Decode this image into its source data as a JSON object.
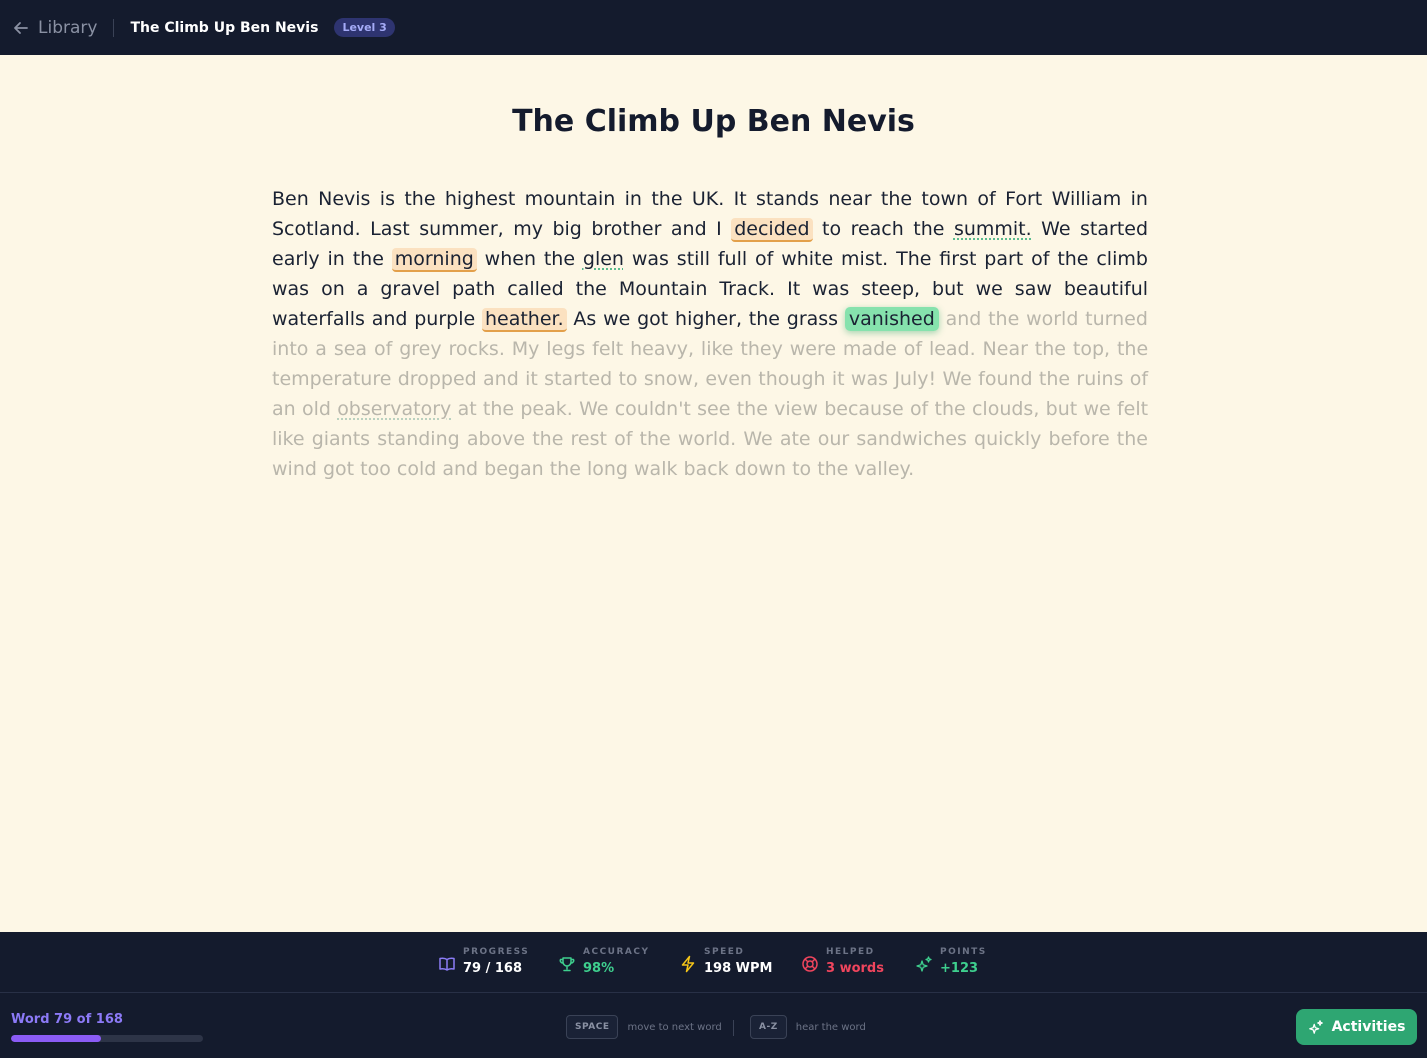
{
  "header": {
    "back_label": "Library",
    "book_title": "The Climb Up Ben Nevis",
    "level_badge": "Level 3"
  },
  "story": {
    "title": "The Climb Up Ben Nevis",
    "current_word_index": 78,
    "words": [
      {
        "t": "Ben",
        "s": "read"
      },
      {
        "t": "Nevis",
        "s": "read"
      },
      {
        "t": "is",
        "s": "read"
      },
      {
        "t": "the",
        "s": "read"
      },
      {
        "t": "highest",
        "s": "read"
      },
      {
        "t": "mountain",
        "s": "read"
      },
      {
        "t": "in",
        "s": "read"
      },
      {
        "t": "the",
        "s": "read"
      },
      {
        "t": "UK.",
        "s": "read"
      },
      {
        "t": "It",
        "s": "read"
      },
      {
        "t": "stands",
        "s": "read"
      },
      {
        "t": "near",
        "s": "read"
      },
      {
        "t": "the",
        "s": "read"
      },
      {
        "t": "town",
        "s": "read"
      },
      {
        "t": "of",
        "s": "read"
      },
      {
        "t": "Fort",
        "s": "read"
      },
      {
        "t": "William",
        "s": "read"
      },
      {
        "t": "in",
        "s": "read"
      },
      {
        "t": "Scotland.",
        "s": "read"
      },
      {
        "t": "Last",
        "s": "read"
      },
      {
        "t": "summer,",
        "s": "read"
      },
      {
        "t": "my",
        "s": "read"
      },
      {
        "t": "big",
        "s": "read"
      },
      {
        "t": "brother",
        "s": "read"
      },
      {
        "t": "and",
        "s": "read"
      },
      {
        "t": "I",
        "s": "read"
      },
      {
        "t": "decided",
        "s": "helped"
      },
      {
        "t": "to",
        "s": "read"
      },
      {
        "t": "reach",
        "s": "read"
      },
      {
        "t": "the",
        "s": "read"
      },
      {
        "t": "summit.",
        "s": "read",
        "gloss": true
      },
      {
        "t": "We",
        "s": "read"
      },
      {
        "t": "started",
        "s": "read"
      },
      {
        "t": "early",
        "s": "read"
      },
      {
        "t": "in",
        "s": "read"
      },
      {
        "t": "the",
        "s": "read"
      },
      {
        "t": "morning",
        "s": "helped"
      },
      {
        "t": "when",
        "s": "read"
      },
      {
        "t": "the",
        "s": "read"
      },
      {
        "t": "glen",
        "s": "read",
        "gloss": true
      },
      {
        "t": "was",
        "s": "read"
      },
      {
        "t": "still",
        "s": "read"
      },
      {
        "t": "full",
        "s": "read"
      },
      {
        "t": "of",
        "s": "read"
      },
      {
        "t": "white",
        "s": "read"
      },
      {
        "t": "mist.",
        "s": "read"
      },
      {
        "t": "The",
        "s": "read"
      },
      {
        "t": "first",
        "s": "read"
      },
      {
        "t": "part",
        "s": "read"
      },
      {
        "t": "of",
        "s": "read"
      },
      {
        "t": "the",
        "s": "read"
      },
      {
        "t": "climb",
        "s": "read"
      },
      {
        "t": "was",
        "s": "read"
      },
      {
        "t": "on",
        "s": "read"
      },
      {
        "t": "a",
        "s": "read"
      },
      {
        "t": "gravel",
        "s": "read"
      },
      {
        "t": "path",
        "s": "read"
      },
      {
        "t": "called",
        "s": "read"
      },
      {
        "t": "the",
        "s": "read"
      },
      {
        "t": "Mountain",
        "s": "read"
      },
      {
        "t": "Track.",
        "s": "read"
      },
      {
        "t": "It",
        "s": "read"
      },
      {
        "t": "was",
        "s": "read"
      },
      {
        "t": "steep,",
        "s": "read"
      },
      {
        "t": "but",
        "s": "read"
      },
      {
        "t": "we",
        "s": "read"
      },
      {
        "t": "saw",
        "s": "read"
      },
      {
        "t": "beautiful",
        "s": "read"
      },
      {
        "t": "waterfalls",
        "s": "read"
      },
      {
        "t": "and",
        "s": "read"
      },
      {
        "t": "purple",
        "s": "read"
      },
      {
        "t": "heather.",
        "s": "helped"
      },
      {
        "t": "As",
        "s": "read"
      },
      {
        "t": "we",
        "s": "read"
      },
      {
        "t": "got",
        "s": "read"
      },
      {
        "t": "higher,",
        "s": "read"
      },
      {
        "t": "the",
        "s": "read"
      },
      {
        "t": "grass",
        "s": "read"
      },
      {
        "t": "vanished",
        "s": "current"
      },
      {
        "t": "and",
        "s": "future"
      },
      {
        "t": "the",
        "s": "future"
      },
      {
        "t": "world",
        "s": "future"
      },
      {
        "t": "turned",
        "s": "future"
      },
      {
        "t": "into",
        "s": "future"
      },
      {
        "t": "a",
        "s": "future"
      },
      {
        "t": "sea",
        "s": "future"
      },
      {
        "t": "of",
        "s": "future"
      },
      {
        "t": "grey",
        "s": "future"
      },
      {
        "t": "rocks.",
        "s": "future"
      },
      {
        "t": "My",
        "s": "future"
      },
      {
        "t": "legs",
        "s": "future"
      },
      {
        "t": "felt",
        "s": "future"
      },
      {
        "t": "heavy,",
        "s": "future"
      },
      {
        "t": "like",
        "s": "future"
      },
      {
        "t": "they",
        "s": "future"
      },
      {
        "t": "were",
        "s": "future"
      },
      {
        "t": "made",
        "s": "future"
      },
      {
        "t": "of",
        "s": "future"
      },
      {
        "t": "lead.",
        "s": "future"
      },
      {
        "t": "Near",
        "s": "future"
      },
      {
        "t": "the",
        "s": "future"
      },
      {
        "t": "top,",
        "s": "future"
      },
      {
        "t": "the",
        "s": "future"
      },
      {
        "t": "temperature",
        "s": "future"
      },
      {
        "t": "dropped",
        "s": "future"
      },
      {
        "t": "and",
        "s": "future"
      },
      {
        "t": "it",
        "s": "future"
      },
      {
        "t": "started",
        "s": "future"
      },
      {
        "t": "to",
        "s": "future"
      },
      {
        "t": "snow,",
        "s": "future"
      },
      {
        "t": "even",
        "s": "future"
      },
      {
        "t": "though",
        "s": "future"
      },
      {
        "t": "it",
        "s": "future"
      },
      {
        "t": "was",
        "s": "future"
      },
      {
        "t": "July!",
        "s": "future"
      },
      {
        "t": "We",
        "s": "future"
      },
      {
        "t": "found",
        "s": "future"
      },
      {
        "t": "the",
        "s": "future"
      },
      {
        "t": "ruins",
        "s": "future"
      },
      {
        "t": "of",
        "s": "future"
      },
      {
        "t": "an",
        "s": "future"
      },
      {
        "t": "old",
        "s": "future"
      },
      {
        "t": "observatory",
        "s": "future",
        "gloss": true
      },
      {
        "t": "at",
        "s": "future"
      },
      {
        "t": "the",
        "s": "future"
      },
      {
        "t": "peak.",
        "s": "future"
      },
      {
        "t": "We",
        "s": "future"
      },
      {
        "t": "couldn't",
        "s": "future"
      },
      {
        "t": "see",
        "s": "future"
      },
      {
        "t": "the",
        "s": "future"
      },
      {
        "t": "view",
        "s": "future"
      },
      {
        "t": "because",
        "s": "future"
      },
      {
        "t": "of",
        "s": "future"
      },
      {
        "t": "the",
        "s": "future"
      },
      {
        "t": "clouds,",
        "s": "future"
      },
      {
        "t": "but",
        "s": "future"
      },
      {
        "t": "we",
        "s": "future"
      },
      {
        "t": "felt",
        "s": "future"
      },
      {
        "t": "like",
        "s": "future"
      },
      {
        "t": "giants",
        "s": "future"
      },
      {
        "t": "standing",
        "s": "future"
      },
      {
        "t": "above",
        "s": "future"
      },
      {
        "t": "the",
        "s": "future"
      },
      {
        "t": "rest",
        "s": "future"
      },
      {
        "t": "of",
        "s": "future"
      },
      {
        "t": "the",
        "s": "future"
      },
      {
        "t": "world.",
        "s": "future"
      },
      {
        "t": "We",
        "s": "future"
      },
      {
        "t": "ate",
        "s": "future"
      },
      {
        "t": "our",
        "s": "future"
      },
      {
        "t": "sandwiches",
        "s": "future"
      },
      {
        "t": "quickly",
        "s": "future"
      },
      {
        "t": "before",
        "s": "future"
      },
      {
        "t": "the",
        "s": "future"
      },
      {
        "t": "wind",
        "s": "future"
      },
      {
        "t": "got",
        "s": "future"
      },
      {
        "t": "too",
        "s": "future"
      },
      {
        "t": "cold",
        "s": "future"
      },
      {
        "t": "and",
        "s": "future"
      },
      {
        "t": "began",
        "s": "future"
      },
      {
        "t": "the",
        "s": "future"
      },
      {
        "t": "long",
        "s": "future"
      },
      {
        "t": "walk",
        "s": "future"
      },
      {
        "t": "back",
        "s": "future"
      },
      {
        "t": "down",
        "s": "future"
      },
      {
        "t": "to",
        "s": "future"
      },
      {
        "t": "the",
        "s": "future"
      },
      {
        "t": "valley.",
        "s": "future"
      }
    ]
  },
  "stats": {
    "progress": {
      "label": "PROGRESS",
      "value": "79 / 168",
      "icon": "book-open-icon",
      "color": "#ffffff",
      "icon_color": "#8b7cf6"
    },
    "accuracy": {
      "label": "ACCURACY",
      "value": "98%",
      "icon": "trophy-icon",
      "color": "#3ecf8e",
      "icon_color": "#3ecf8e"
    },
    "speed": {
      "label": "SPEED",
      "value": "198 WPM",
      "icon": "lightning-icon",
      "color": "#ffffff",
      "icon_color": "#f5c518"
    },
    "helped": {
      "label": "HELPED",
      "value": "3 words",
      "icon": "lifebuoy-icon",
      "color": "#f0455d",
      "icon_color": "#f0455d"
    },
    "points": {
      "label": "POINTS",
      "value": "+123",
      "icon": "sparkles-icon",
      "color": "#3ecf8e",
      "icon_color": "#3ecf8e"
    }
  },
  "footer": {
    "word_counter": "Word 79 of 168",
    "progress_fraction": 0.47,
    "hints": [
      {
        "key": "SPACE",
        "text": "move to next word"
      },
      {
        "key": "A-Z",
        "text": "hear the word"
      }
    ],
    "activities_label": "Activities"
  },
  "colors": {
    "page_bg": "#fdf7e6",
    "bar_bg": "#141b2d",
    "accent_purple": "#8b5cf6",
    "current_word_bg": "#86e2ad",
    "helped_word_bg": "#fbe1c0",
    "activities_bg": "#2ea672"
  }
}
